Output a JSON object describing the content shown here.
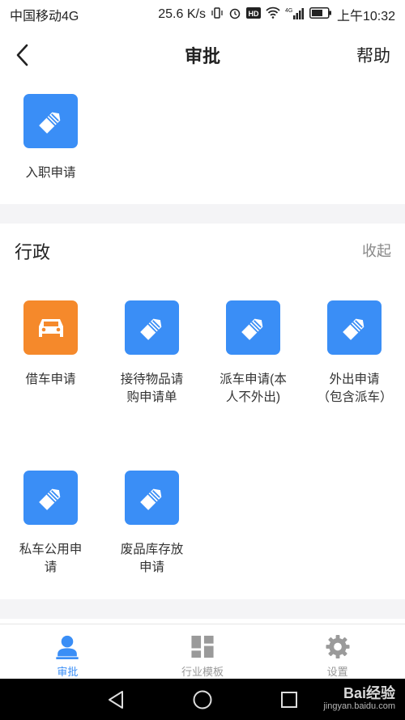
{
  "status_bar": {
    "carrier": "中国移动4G",
    "speed": "25.6 K/s",
    "network": "4G",
    "time": "上午10:32"
  },
  "nav": {
    "title": "审批",
    "help_label": "帮助"
  },
  "top_section": {
    "items": [
      {
        "label": "入职申请",
        "icon": "tag-icon",
        "color": "#3a8ef6"
      }
    ]
  },
  "admin_section": {
    "title": "行政",
    "toggle_label": "收起",
    "items": [
      {
        "label": "借车申请",
        "icon": "car-icon",
        "color": "#f5892b"
      },
      {
        "label": "接待物品请购申请单",
        "icon": "tag-icon",
        "color": "#3a8ef6"
      },
      {
        "label": "派车申请(本人不外出)",
        "icon": "tag-icon",
        "color": "#3a8ef6"
      },
      {
        "label": "外出申请（包含派车）",
        "icon": "tag-icon",
        "color": "#3a8ef6"
      },
      {
        "label": "私车公用申请",
        "icon": "tag-icon",
        "color": "#3a8ef6"
      },
      {
        "label": "废品库存放申请",
        "icon": "tag-icon",
        "color": "#3a8ef6"
      }
    ]
  },
  "tabbar": {
    "tabs": [
      {
        "label": "审批",
        "icon": "person-icon",
        "active": true
      },
      {
        "label": "行业模板",
        "icon": "grid-icon",
        "active": false
      },
      {
        "label": "设置",
        "icon": "gear-icon",
        "active": false
      }
    ]
  },
  "colors": {
    "accent": "#3a8ef6",
    "orange": "#f5892b"
  },
  "watermark": {
    "main": "Bai经验",
    "sub": "jingyan.baidu.com"
  }
}
